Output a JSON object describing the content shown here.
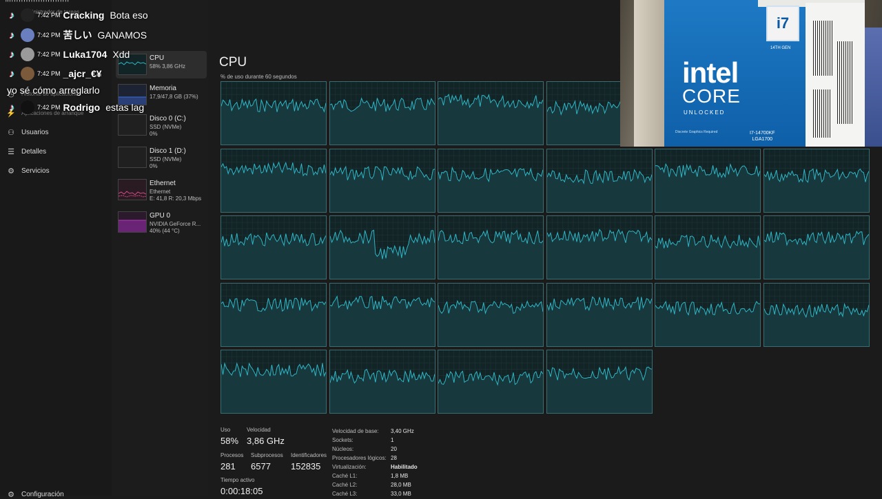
{
  "nav": {
    "top_partial": "ministrador de tareas",
    "history_partial": "Historial de aplicaciones",
    "startup_partial": "Aplicaciones de arranque",
    "items": [
      {
        "label": "Usuarios",
        "icon": "users-icon"
      },
      {
        "label": "Detalles",
        "icon": "list-icon"
      },
      {
        "label": "Servicios",
        "icon": "puzzle-icon"
      }
    ],
    "settings_label": "Configuración"
  },
  "resources": [
    {
      "title": "CPU",
      "line1": "58% 3,86 GHz",
      "line2": ""
    },
    {
      "title": "Memoria",
      "line1": "17,9/47,8 GB (37%)",
      "line2": ""
    },
    {
      "title": "Disco 0 (C:)",
      "line1": "SSD (NVMe)",
      "line2": "0%"
    },
    {
      "title": "Disco 1 (D:)",
      "line1": "SSD (NVMe)",
      "line2": "0%"
    },
    {
      "title": "Ethernet",
      "line1": "Ethernet",
      "line2": "E: 41,8 R: 20,3 Mbps"
    },
    {
      "title": "GPU 0",
      "line1": "NVIDIA GeForce R...",
      "line2": "40% (44 °C)"
    }
  ],
  "main": {
    "title": "CPU",
    "subtitle": "% de uso durante 60 segundos"
  },
  "stats": {
    "uso_label": "Uso",
    "uso_value": "58%",
    "vel_label": "Velocidad",
    "vel_value": "3,86 GHz",
    "proc_label": "Procesos",
    "proc_value": "281",
    "sub_label": "Subprocesos",
    "sub_value": "6577",
    "id_label": "Identificadores",
    "id_value": "152835",
    "time_label": "Tiempo activo",
    "time_value": "0:00:18:05"
  },
  "specs": [
    {
      "k": "Velocidad de base:",
      "v": "3,40 GHz"
    },
    {
      "k": "Sockets:",
      "v": "1"
    },
    {
      "k": "Núcleos:",
      "v": "20"
    },
    {
      "k": "Procesadores lógicos:",
      "v": "28"
    },
    {
      "k": "Virtualización:",
      "v": "Habilitado"
    },
    {
      "k": "Caché L1:",
      "v": "1,8 MB"
    },
    {
      "k": "Caché L2:",
      "v": "28,0 MB"
    },
    {
      "k": "Caché L3:",
      "v": "33,0 MB"
    }
  ],
  "chat": {
    "top_partial": "ʰᶠᶠᶠᶠᶠᶠᶠᶠᶠᶠᶠᶠᶠᶠᶠᶠᶠᶠᶠᶠᶠᶠᶠᶠᶠ",
    "messages": [
      {
        "time": "7:42 PM",
        "user": "Cracking",
        "msg": "Bota eso"
      },
      {
        "time": "7:42 PM",
        "user": "苦しい",
        "msg": "GANAMOS"
      },
      {
        "time": "7:42 PM",
        "user": "Luka1704",
        "msg": "Xdd"
      },
      {
        "time": "7:42 PM",
        "user": "_ajcr_€¥",
        "msg": ""
      },
      {
        "time": "7:42 PM",
        "user": "Rodrigo",
        "msg": "estas lag"
      }
    ],
    "wrap_msg": "yo sé cómo arreglarlo"
  },
  "webcam": {
    "brand": "intel",
    "line": "CORE",
    "unlocked": "UNLOCKED",
    "tier": "i7",
    "gen": "14TH GEN",
    "disclaimer": "Discrete Graphics Required",
    "model": "I7-14700KF",
    "socket": "LGA1700"
  },
  "colors": {
    "graph_line": "#2fb8c9",
    "graph_bg": "#122426",
    "graph_border": "#3b6e73",
    "memory": "#3b6ed8",
    "ethernet": "#d84a8a",
    "gpu": "#b03bb8"
  }
}
